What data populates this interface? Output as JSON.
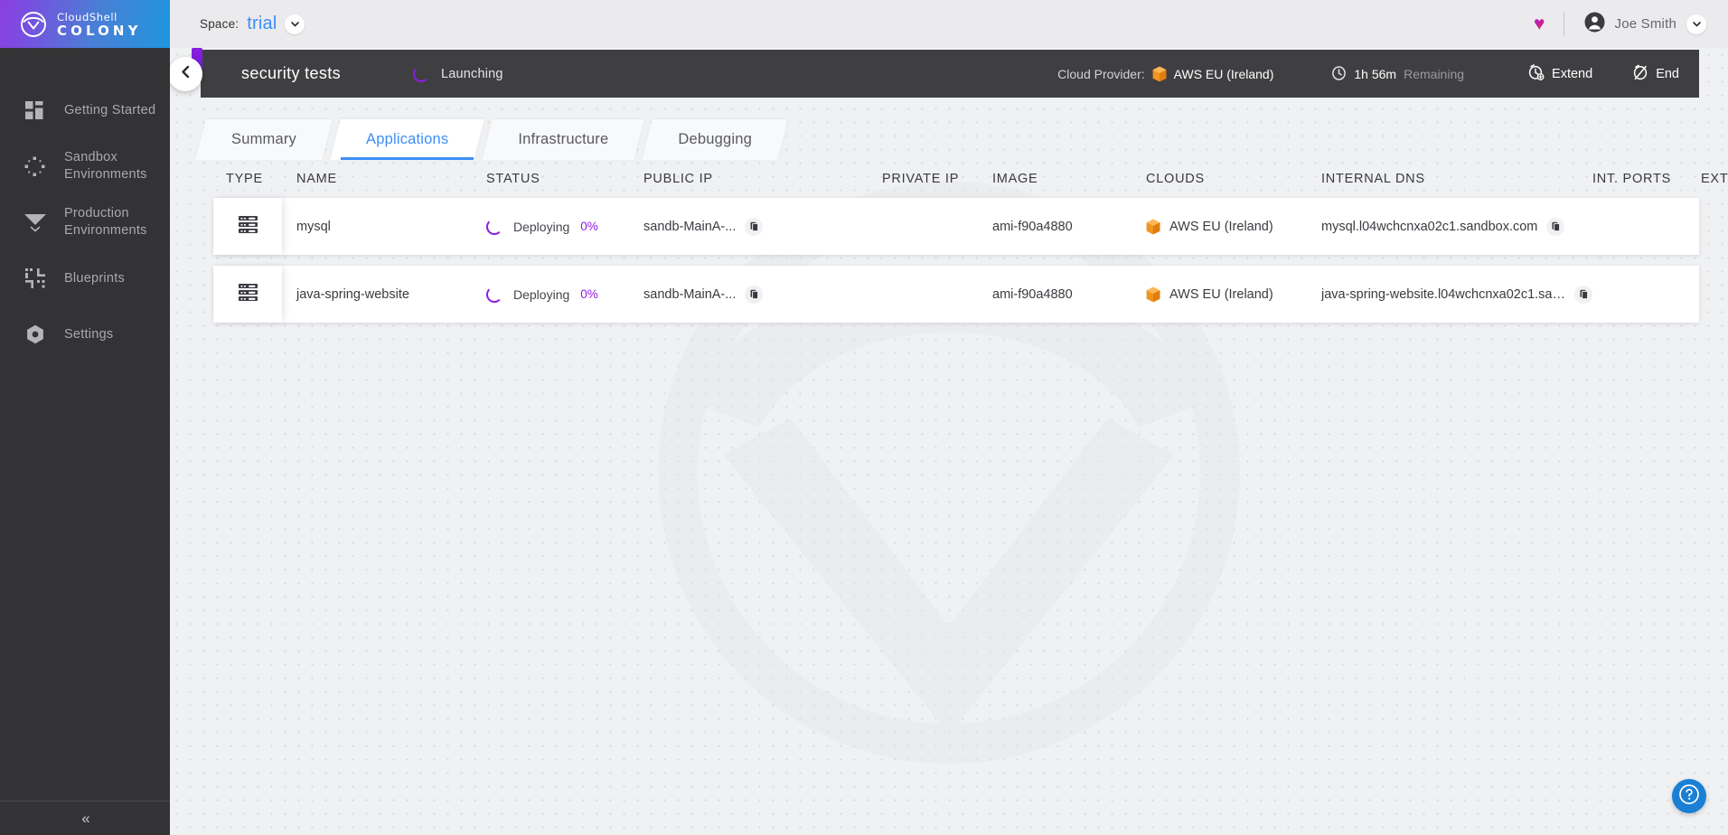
{
  "brand": {
    "top": "CloudShell",
    "bottom": "COLONY",
    "logo_icon": "colony-logo-icon"
  },
  "sidebar": {
    "items": [
      {
        "label": "Getting Started",
        "icon": "grid-tiles-icon"
      },
      {
        "label": "Sandbox Environments",
        "icon": "sandbox-diamond-icon"
      },
      {
        "label": "Production Environments",
        "icon": "funnel-chevron-icon"
      },
      {
        "label": "Blueprints",
        "icon": "blueprint-corners-icon"
      },
      {
        "label": "Settings",
        "icon": "gear-hex-icon"
      }
    ],
    "collapse_label": "«",
    "collapse_icon": "double-chevron-left-icon"
  },
  "topbar": {
    "space_label": "Space:",
    "space_value": "trial",
    "space_chevron_icon": "chevron-down-icon",
    "favorite_icon": "heart-icon",
    "favorite_glyph": "♥",
    "user_icon": "avatar-icon",
    "user_name": "Joe Smith",
    "user_chevron_icon": "chevron-down-icon"
  },
  "sandbox_header": {
    "back_icon": "chevron-left-icon",
    "title": "security tests",
    "status": "Launching",
    "status_icon": "spinner-icon",
    "cloud_provider_label": "Cloud Provider:",
    "cloud_provider_value": "AWS EU (Ireland)",
    "cloud_provider_icon": "aws-cube-icon",
    "time_icon": "clock-icon",
    "time_value": "1h 56m",
    "time_suffix": "Remaining",
    "extend_label": "Extend",
    "extend_icon": "clock-extend-icon",
    "end_label": "End",
    "end_icon": "clock-end-icon"
  },
  "tabs": [
    {
      "label": "Summary",
      "active": false
    },
    {
      "label": "Applications",
      "active": true
    },
    {
      "label": "Infrastructure",
      "active": false
    },
    {
      "label": "Debugging",
      "active": false
    }
  ],
  "table": {
    "columns": [
      "TYPE",
      "NAME",
      "STATUS",
      "PUBLIC IP",
      "PRIVATE IP",
      "IMAGE",
      "CLOUDS",
      "INTERNAL DNS",
      "INT. PORTS",
      "EXT. PORTS"
    ],
    "rows": [
      {
        "type_icon": "server-stack-icon",
        "name": "mysql",
        "status": "Deploying",
        "status_percent": "0%",
        "public_ip": "sandb-MainA-...",
        "public_ip_copy_icon": "copy-icon",
        "private_ip": "",
        "image": "ami-f90a4880",
        "cloud_icon": "aws-cube-icon",
        "cloud": "AWS EU (Ireland)",
        "internal_dns": "mysql.l04wchcnxa02c1.sandbox.com",
        "dns_copy_icon": "copy-icon",
        "int_ports": "",
        "ext_ports": ""
      },
      {
        "type_icon": "server-stack-icon",
        "name": "java-spring-website",
        "status": "Deploying",
        "status_percent": "0%",
        "public_ip": "sandb-MainA-...",
        "public_ip_copy_icon": "copy-icon",
        "private_ip": "",
        "image": "ami-f90a4880",
        "cloud_icon": "aws-cube-icon",
        "cloud": "AWS EU (Ireland)",
        "internal_dns": "java-spring-website.l04wchcnxa02c1.san...",
        "dns_copy_icon": "copy-icon",
        "int_ports": "",
        "ext_ports": ""
      }
    ]
  },
  "help": {
    "icon": "question-circle-icon"
  },
  "colors": {
    "accent_blue": "#3d8ef5",
    "accent_purple": "#8b1ce0",
    "aws_orange": "#f0951f",
    "sidebar_bg": "#333335",
    "header_bg": "#3f3f42",
    "help_blue": "#1b7fd4"
  }
}
